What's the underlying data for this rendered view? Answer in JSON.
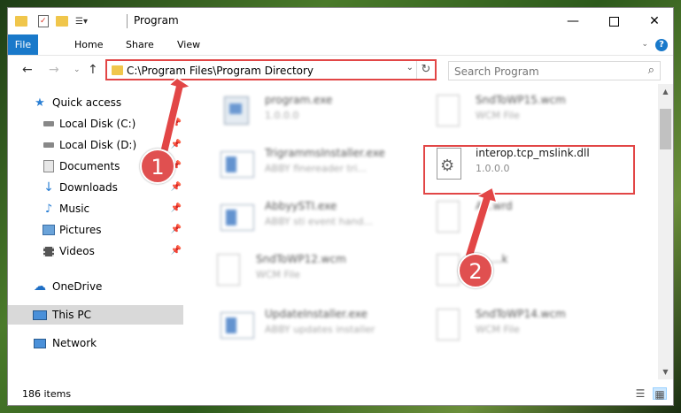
{
  "window": {
    "title": "Program",
    "minimize_icon": "minimize-icon",
    "maximize_icon": "maximize-icon",
    "close_icon": "close-icon"
  },
  "ribbon": {
    "tabs": [
      "File",
      "Home",
      "Share",
      "View"
    ],
    "help_label": "?"
  },
  "navigation": {
    "address": "C:\\Program Files\\Program Directory",
    "search_placeholder": "Search Program"
  },
  "sidebar": {
    "items": [
      {
        "label": "Quick access",
        "icon": "star-icon",
        "pinned": false
      },
      {
        "label": "Local Disk (C:)",
        "icon": "drive-icon",
        "pinned": true
      },
      {
        "label": "Local Disk (D:)",
        "icon": "drive-icon",
        "pinned": true
      },
      {
        "label": "Documents",
        "icon": "documents-icon",
        "pinned": true
      },
      {
        "label": "Downloads",
        "icon": "download-icon",
        "pinned": true
      },
      {
        "label": "Music",
        "icon": "music-icon",
        "pinned": true
      },
      {
        "label": "Pictures",
        "icon": "pictures-icon",
        "pinned": true
      },
      {
        "label": "Videos",
        "icon": "videos-icon",
        "pinned": true
      },
      {
        "label": "OneDrive",
        "icon": "cloud-icon",
        "pinned": false
      },
      {
        "label": "This PC",
        "icon": "computer-icon",
        "pinned": false
      },
      {
        "label": "Network",
        "icon": "network-icon",
        "pinned": false
      }
    ]
  },
  "files": [
    {
      "name": "program.exe",
      "desc": "1.0.0.0",
      "icon": "installer-icon"
    },
    {
      "name": "SndToWP15.wcm",
      "desc": "WCM File",
      "icon": "blank-file-icon"
    },
    {
      "name": "TrigrammsInstaller.exe",
      "desc": "ABBY finereader tri...",
      "icon": "app-window-icon"
    },
    {
      "name": "interop.tcp_mslink.dll",
      "desc": "1.0.0.0",
      "icon": "dll-gear-icon"
    },
    {
      "name": "AbbyySTI.exe",
      "desc": "ABBY sti event hand...",
      "icon": "app-window-icon"
    },
    {
      "name": "A...wrd",
      "desc": "",
      "icon": "blank-file-icon"
    },
    {
      "name": "SndToWP12.wcm",
      "desc": "WCM File",
      "icon": "blank-file-icon"
    },
    {
      "name": "...k",
      "desc": "",
      "icon": "blank-file-icon"
    },
    {
      "name": "UpdateInstaller.exe",
      "desc": "ABBY updates installer",
      "icon": "app-window-icon"
    },
    {
      "name": "SndToWP14.wcm",
      "desc": "WCM File",
      "icon": "blank-file-icon"
    }
  ],
  "annotations": {
    "step1": "1",
    "step2": "2",
    "color": "#e24646"
  },
  "status": {
    "count": "186 items"
  }
}
